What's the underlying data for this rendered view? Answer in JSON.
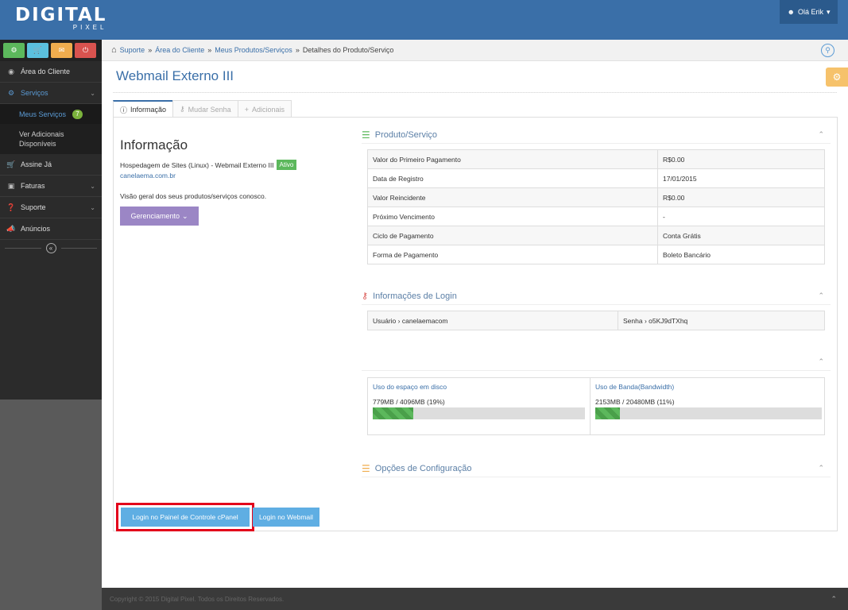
{
  "brand": {
    "line1": "DIGITAL",
    "line2": "PIXEL"
  },
  "user": {
    "label": "Olá Erik",
    "icon": "user-icon"
  },
  "quick_actions": [
    {
      "name": "config",
      "icon": "gears-icon",
      "color": "#5cb85c"
    },
    {
      "name": "cart",
      "icon": "cart-icon",
      "color": "#5bc0de"
    },
    {
      "name": "support",
      "icon": "comments-icon",
      "color": "#f0ad4e"
    },
    {
      "name": "logout",
      "icon": "power-icon",
      "color": "#d9534f"
    }
  ],
  "sidebar": {
    "items": [
      {
        "label": "Área do Cliente",
        "icon": "dashboard-icon"
      },
      {
        "label": "Serviços",
        "icon": "gears-icon"
      },
      {
        "label": "Assine Já",
        "icon": "cart-icon"
      },
      {
        "label": "Faturas",
        "icon": "money-icon"
      },
      {
        "label": "Suporte",
        "icon": "question-icon"
      },
      {
        "label": "Anúncios",
        "icon": "bullhorn-icon"
      }
    ],
    "sub": [
      {
        "label": "Meus Serviços",
        "badge": "7"
      },
      {
        "label": "Ver Adicionais Disponíveis"
      }
    ]
  },
  "breadcrumb": {
    "items": [
      "Suporte",
      "Área do Cliente",
      "Meus Produtos/Serviços"
    ],
    "current": "Detalhes do Produto/Serviço",
    "sep": "»"
  },
  "page": {
    "title": "Webmail Externo III"
  },
  "tabs": [
    {
      "label": "Informação",
      "icon": "info-icon"
    },
    {
      "label": "Mudar Senha",
      "icon": "key-icon"
    },
    {
      "label": "Adicionais",
      "icon": "plus-icon"
    }
  ],
  "info": {
    "heading": "Informação",
    "product_line": "Hospedagem de Sites (Linux) - Webmail Externo III",
    "status": "Ativo",
    "domain": "canelaema.com.br",
    "overview": "Visão geral dos seus produtos/serviços conosco.",
    "manage_button": "Gerenciamento"
  },
  "product": {
    "title": "Produto/Serviço",
    "rows": [
      {
        "label": "Valor do Primeiro Pagamento",
        "value": "R$0.00"
      },
      {
        "label": "Data de Registro",
        "value": "17/01/2015"
      },
      {
        "label": "Valor Reincidente",
        "value": "R$0.00"
      },
      {
        "label": "Próximo Vencimento",
        "value": "-"
      },
      {
        "label": "Ciclo de Pagamento",
        "value": "Conta Grátis"
      },
      {
        "label": "Forma de Pagamento",
        "value": "Boleto Bancário"
      }
    ]
  },
  "login_info": {
    "title": "Informações de Login",
    "user": "Usuário › canelaemacom",
    "password": "Senha › o5KJ9dTXhq"
  },
  "usage": {
    "disk": {
      "label": "Uso do espaço em disco",
      "value": "779MB / 4096MB (19%)",
      "percent": 19
    },
    "bandwidth": {
      "label": "Uso de Banda(Bandwidth)",
      "value": "2153MB / 20480MB (11%)",
      "percent": 11
    }
  },
  "config_options": {
    "title": "Opções de Configuração"
  },
  "buttons": {
    "cpanel": "Login no Painel de Controle cPanel",
    "webmail": "Login no Webmail"
  },
  "footer": {
    "text": "Copyright © 2015 Digital Pixel. Todos os Direitos Reservados."
  },
  "colors": {
    "primary": "#3a6fa8",
    "accent_red": "#e3001b"
  }
}
